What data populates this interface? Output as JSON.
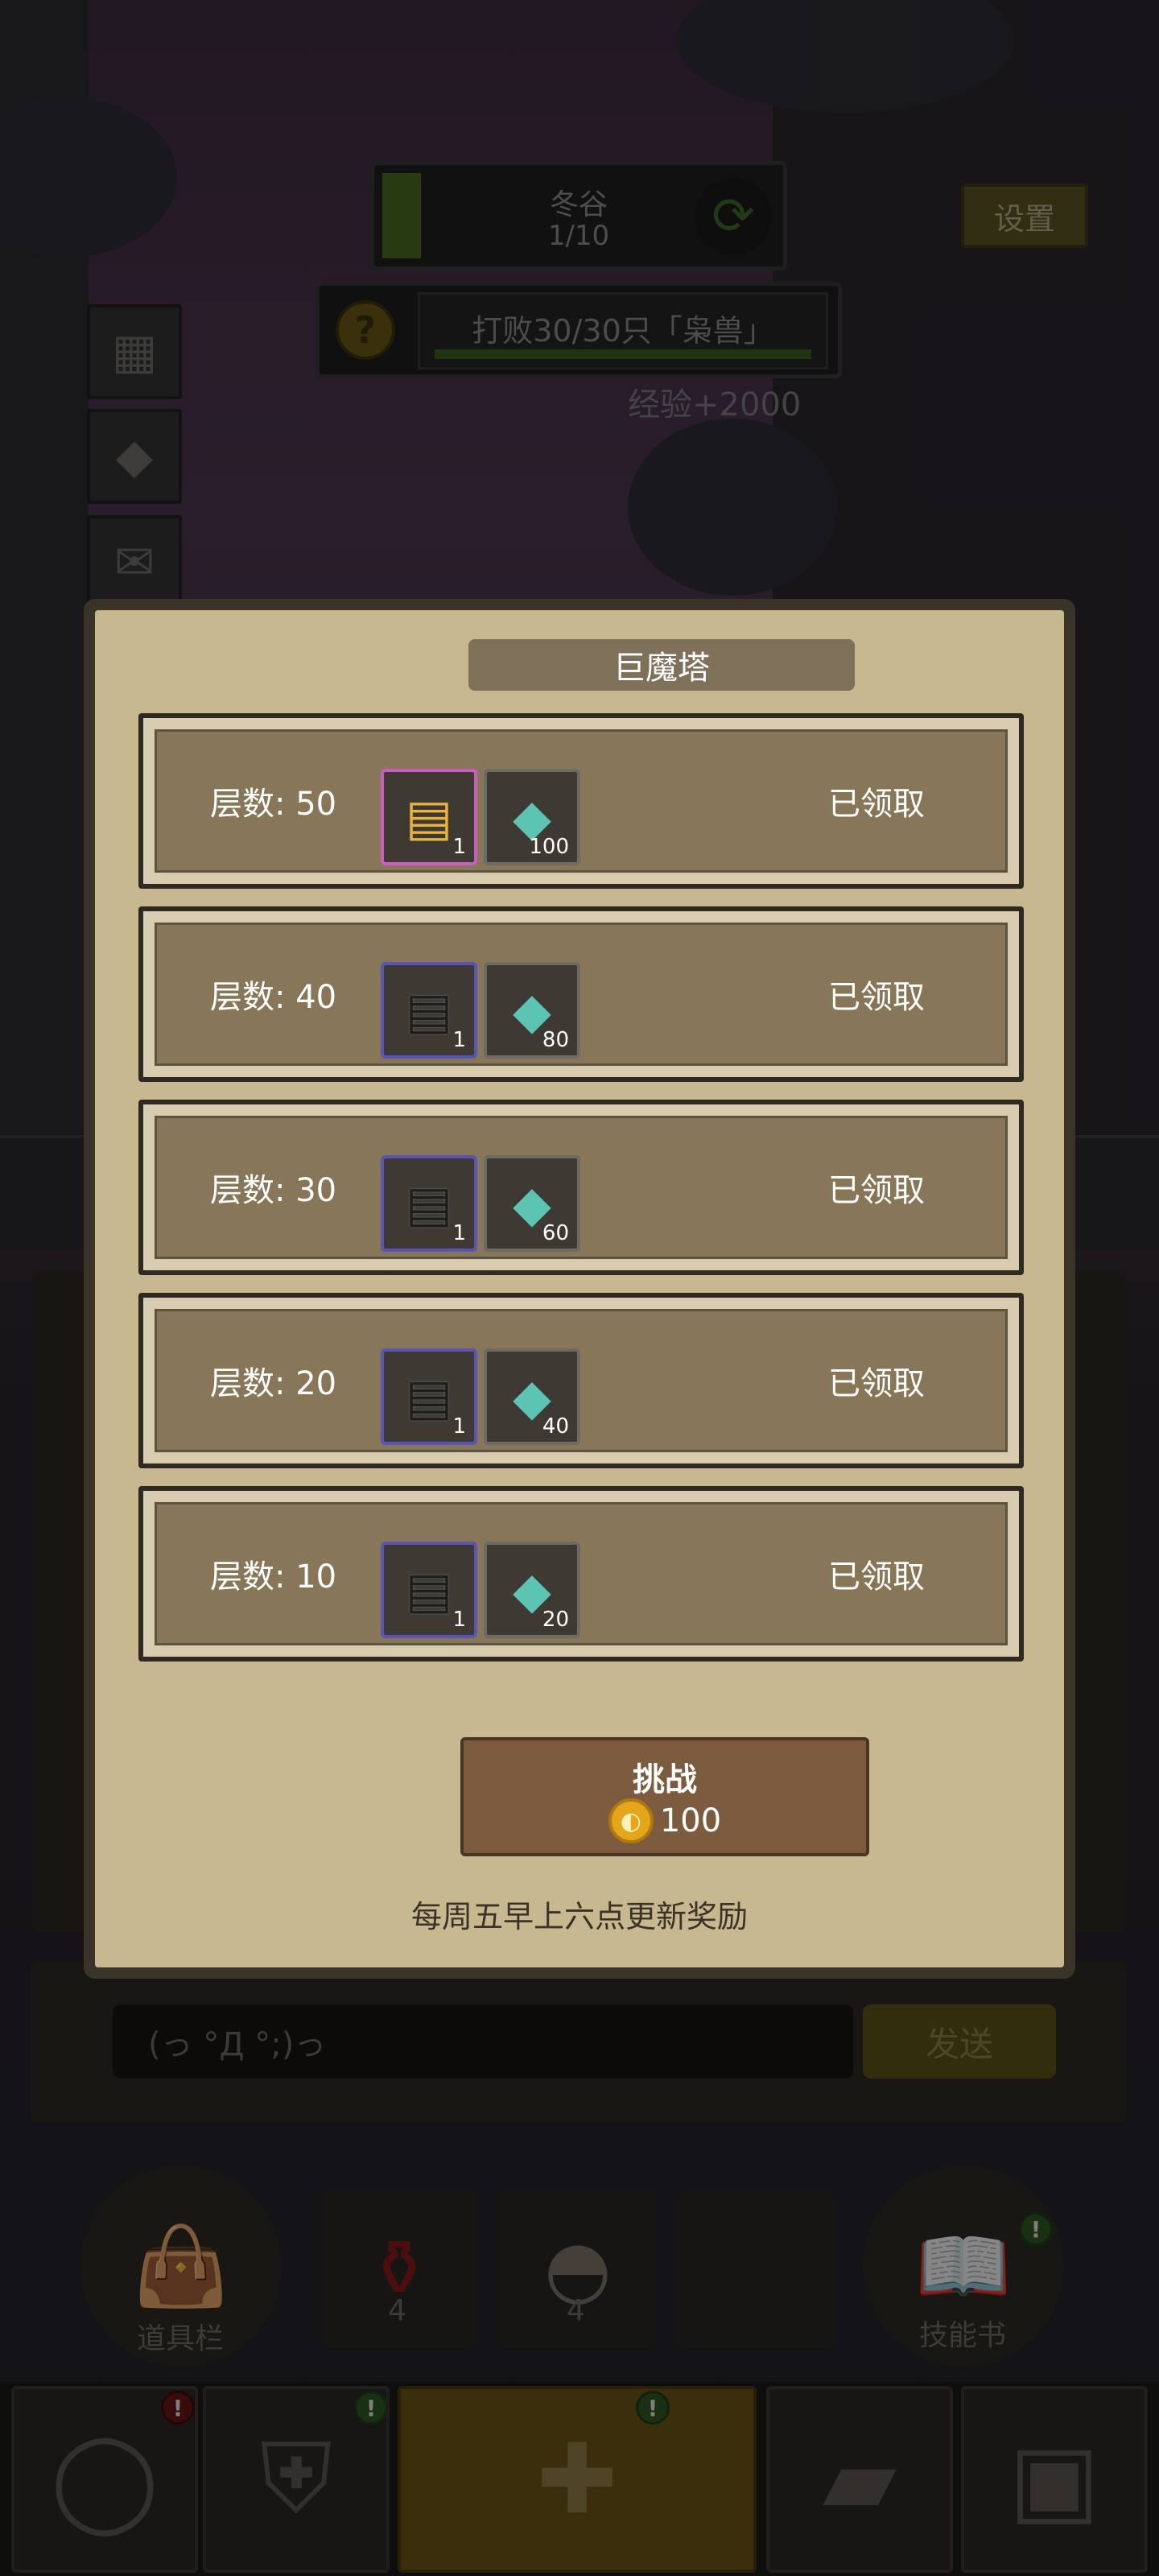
{
  "hud": {
    "stage_name": "冬谷",
    "stage_progress": "1/10",
    "settings_label": "设置",
    "quest_text": "打败30/30只「枭兽」",
    "quest_progress": 1.0,
    "exp_reward": "经验+2000",
    "refresh_icon": "cycle-arrows-icon"
  },
  "side_icons": [
    {
      "name": "map-scroll-icon",
      "glyph": "▦"
    },
    {
      "name": "ore-rock-icon",
      "glyph": "◆"
    },
    {
      "name": "mail-icon",
      "glyph": "✉"
    }
  ],
  "modal": {
    "title": "巨魔塔",
    "floor_prefix": "层数:",
    "rewards": [
      {
        "floor_text": "层数: 50",
        "chest": "gold",
        "chest_qty": "1",
        "gem_qty": "100",
        "status": "已领取"
      },
      {
        "floor_text": "层数: 40",
        "chest": "dark",
        "chest_qty": "1",
        "gem_qty": "80",
        "status": "已领取"
      },
      {
        "floor_text": "层数: 30",
        "chest": "dark",
        "chest_qty": "1",
        "gem_qty": "60",
        "status": "已领取"
      },
      {
        "floor_text": "层数: 20",
        "chest": "dark",
        "chest_qty": "1",
        "gem_qty": "40",
        "status": "已领取"
      },
      {
        "floor_text": "层数: 10",
        "chest": "dark",
        "chest_qty": "1",
        "gem_qty": "20",
        "status": "已领取"
      }
    ],
    "challenge_label": "挑战",
    "challenge_cost": "100",
    "refresh_note": "每周五早上六点更新奖励"
  },
  "chat": {
    "input_value": "(っ °Д °;)っ",
    "send_label": "发送"
  },
  "actions": {
    "inventory_label": "道具栏",
    "potion_count": "4",
    "food_count": "4",
    "skillbook_label": "技能书"
  },
  "colors": {
    "modal_bg": "#c8b890",
    "row_fill": "#877657",
    "gold_border": "#c95ec0",
    "blue_border": "#5955b8",
    "gem": "#5cc4b3",
    "coin": "#e5a61d"
  }
}
